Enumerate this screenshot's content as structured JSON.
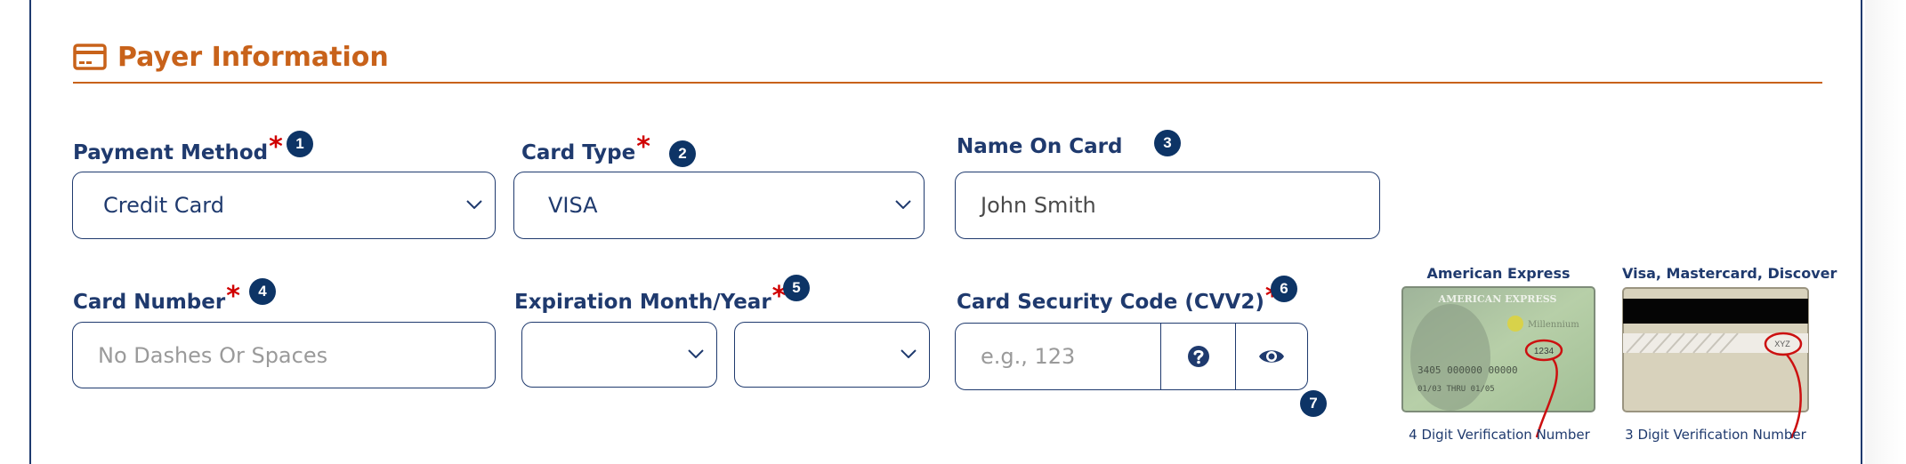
{
  "section": {
    "title": "Payer Information",
    "icon": "credit-card-icon",
    "accent_color": "#c8621a"
  },
  "fields": {
    "payment_method": {
      "label": "Payment Method",
      "required_mark": "*",
      "badge": "1",
      "value": "Credit Card"
    },
    "card_type": {
      "label": "Card Type",
      "required_mark": "*",
      "badge": "2",
      "value": "VISA"
    },
    "name_on_card": {
      "label": "Name On Card",
      "badge": "3",
      "value": "John Smith"
    },
    "card_number": {
      "label": "Card Number",
      "required_mark": "*",
      "badge": "4",
      "value": "",
      "placeholder": "No Dashes Or Spaces"
    },
    "expiration": {
      "label": "Expiration Month/Year",
      "required_mark": "*",
      "badge": "5",
      "month_value": "",
      "year_value": ""
    },
    "cvv": {
      "label": "Card Security Code (CVV2)",
      "required_mark": "*",
      "badge": "6",
      "value": "",
      "placeholder": "e.g., 123",
      "help_icon": "question-circle-icon",
      "toggle_icon": "eye-icon",
      "toggle_badge": "7"
    }
  },
  "cvv_help": {
    "amex": {
      "title": "American Express",
      "caption": "4 Digit Verification Number",
      "sample_code": "1234",
      "card_number": "3405 000000 00000",
      "dates": "01/03 THRU 01/05",
      "brand": "AMERICAN EXPRESS",
      "tagline": "Millennium"
    },
    "others": {
      "title": "Visa, Mastercard, Discover",
      "caption": "3 Digit Verification Number",
      "sample_code": "XYZ"
    }
  },
  "colors": {
    "label": "#1f3a6e",
    "required": "#d00000",
    "badge": "#0d3466",
    "placeholder": "#9a9a9a"
  }
}
